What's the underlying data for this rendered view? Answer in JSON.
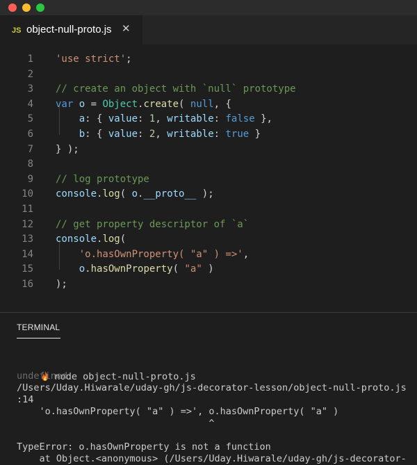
{
  "window": {
    "controls": [
      "close",
      "minimize",
      "maximize"
    ]
  },
  "tab": {
    "icon_text": "JS",
    "label": "object-null-proto.js",
    "close_glyph": "✕",
    "icon": "close-icon"
  },
  "editor": {
    "language": "javascript",
    "lines": [
      {
        "n": "1",
        "tokens": [
          {
            "t": "'use strict'",
            "c": "str"
          },
          {
            "t": ";",
            "c": "pun"
          }
        ]
      },
      {
        "n": "2",
        "tokens": []
      },
      {
        "n": "3",
        "tokens": [
          {
            "t": "// create an object with `null` prototype",
            "c": "com"
          }
        ]
      },
      {
        "n": "4",
        "tokens": [
          {
            "t": "var ",
            "c": "kw"
          },
          {
            "t": "o",
            "c": "var"
          },
          {
            "t": " = ",
            "c": "pun"
          },
          {
            "t": "Object",
            "c": "cls"
          },
          {
            "t": ".",
            "c": "pun"
          },
          {
            "t": "create",
            "c": "fn"
          },
          {
            "t": "( ",
            "c": "pun"
          },
          {
            "t": "null",
            "c": "kw"
          },
          {
            "t": ", {",
            "c": "pun"
          }
        ]
      },
      {
        "n": "5",
        "tokens": [
          {
            "t": "    ",
            "c": "pun"
          },
          {
            "t": "a",
            "c": "var"
          },
          {
            "t": ": { ",
            "c": "pun"
          },
          {
            "t": "value",
            "c": "var"
          },
          {
            "t": ": ",
            "c": "pun"
          },
          {
            "t": "1",
            "c": "num"
          },
          {
            "t": ", ",
            "c": "pun"
          },
          {
            "t": "writable",
            "c": "var"
          },
          {
            "t": ": ",
            "c": "pun"
          },
          {
            "t": "false",
            "c": "kw"
          },
          {
            "t": " },",
            "c": "pun"
          }
        ]
      },
      {
        "n": "6",
        "tokens": [
          {
            "t": "    ",
            "c": "pun"
          },
          {
            "t": "b",
            "c": "var"
          },
          {
            "t": ": { ",
            "c": "pun"
          },
          {
            "t": "value",
            "c": "var"
          },
          {
            "t": ": ",
            "c": "pun"
          },
          {
            "t": "2",
            "c": "num"
          },
          {
            "t": ", ",
            "c": "pun"
          },
          {
            "t": "writable",
            "c": "var"
          },
          {
            "t": ": ",
            "c": "pun"
          },
          {
            "t": "true",
            "c": "kw"
          },
          {
            "t": " }",
            "c": "pun"
          }
        ]
      },
      {
        "n": "7",
        "tokens": [
          {
            "t": "} );",
            "c": "pun"
          }
        ]
      },
      {
        "n": "8",
        "tokens": []
      },
      {
        "n": "9",
        "tokens": [
          {
            "t": "// log prototype",
            "c": "com"
          }
        ]
      },
      {
        "n": "10",
        "tokens": [
          {
            "t": "console",
            "c": "var"
          },
          {
            "t": ".",
            "c": "pun"
          },
          {
            "t": "log",
            "c": "fn"
          },
          {
            "t": "( ",
            "c": "pun"
          },
          {
            "t": "o",
            "c": "var"
          },
          {
            "t": ".",
            "c": "pun"
          },
          {
            "t": "__proto__",
            "c": "var"
          },
          {
            "t": " );",
            "c": "pun"
          }
        ]
      },
      {
        "n": "11",
        "tokens": []
      },
      {
        "n": "12",
        "tokens": [
          {
            "t": "// get property descriptor of `a`",
            "c": "com"
          }
        ]
      },
      {
        "n": "13",
        "tokens": [
          {
            "t": "console",
            "c": "var"
          },
          {
            "t": ".",
            "c": "pun"
          },
          {
            "t": "log",
            "c": "fn"
          },
          {
            "t": "(",
            "c": "pun"
          }
        ]
      },
      {
        "n": "14",
        "tokens": [
          {
            "t": "    ",
            "c": "pun"
          },
          {
            "t": "'o.hasOwnProperty( \"a\" ) =>'",
            "c": "str"
          },
          {
            "t": ",",
            "c": "pun"
          }
        ]
      },
      {
        "n": "15",
        "tokens": [
          {
            "t": "    ",
            "c": "pun"
          },
          {
            "t": "o",
            "c": "var"
          },
          {
            "t": ".",
            "c": "pun"
          },
          {
            "t": "hasOwnProperty",
            "c": "fn"
          },
          {
            "t": "( ",
            "c": "pun"
          },
          {
            "t": "\"a\"",
            "c": "str"
          },
          {
            "t": " )",
            "c": "pun"
          }
        ]
      },
      {
        "n": "16",
        "tokens": [
          {
            "t": ");",
            "c": "pun"
          }
        ]
      }
    ]
  },
  "terminal": {
    "tab_label": "TERMINAL",
    "prompt_icon": "flame-icon",
    "command": "node object-null-proto.js",
    "output": [
      {
        "text": "undefined",
        "style": "dim"
      },
      {
        "text": "/Users/Uday.Hiwarale/uday-gh/js-decorator-lesson/object-null-proto.js",
        "style": "normal"
      },
      {
        "text": ":14",
        "style": "normal"
      },
      {
        "text": "    'o.hasOwnProperty( \"a\" ) =>', o.hasOwnProperty( \"a\" )",
        "style": "normal"
      },
      {
        "text": "                                  ^",
        "style": "normal"
      },
      {
        "text": "",
        "style": "normal"
      },
      {
        "text": "TypeError: o.hasOwnProperty is not a function",
        "style": "normal"
      },
      {
        "text": "    at Object.<anonymous> (/Users/Uday.Hiwarale/uday-gh/js-decorator-",
        "style": "normal"
      }
    ]
  },
  "colors": {
    "str": "#ce9178",
    "com": "#6a9955",
    "kw": "#569cd6",
    "var": "#9cdcfe",
    "cls": "#4ec9b0",
    "fn": "#dcdcaa",
    "num": "#b5cea8",
    "pun": "#d4d4d4"
  }
}
